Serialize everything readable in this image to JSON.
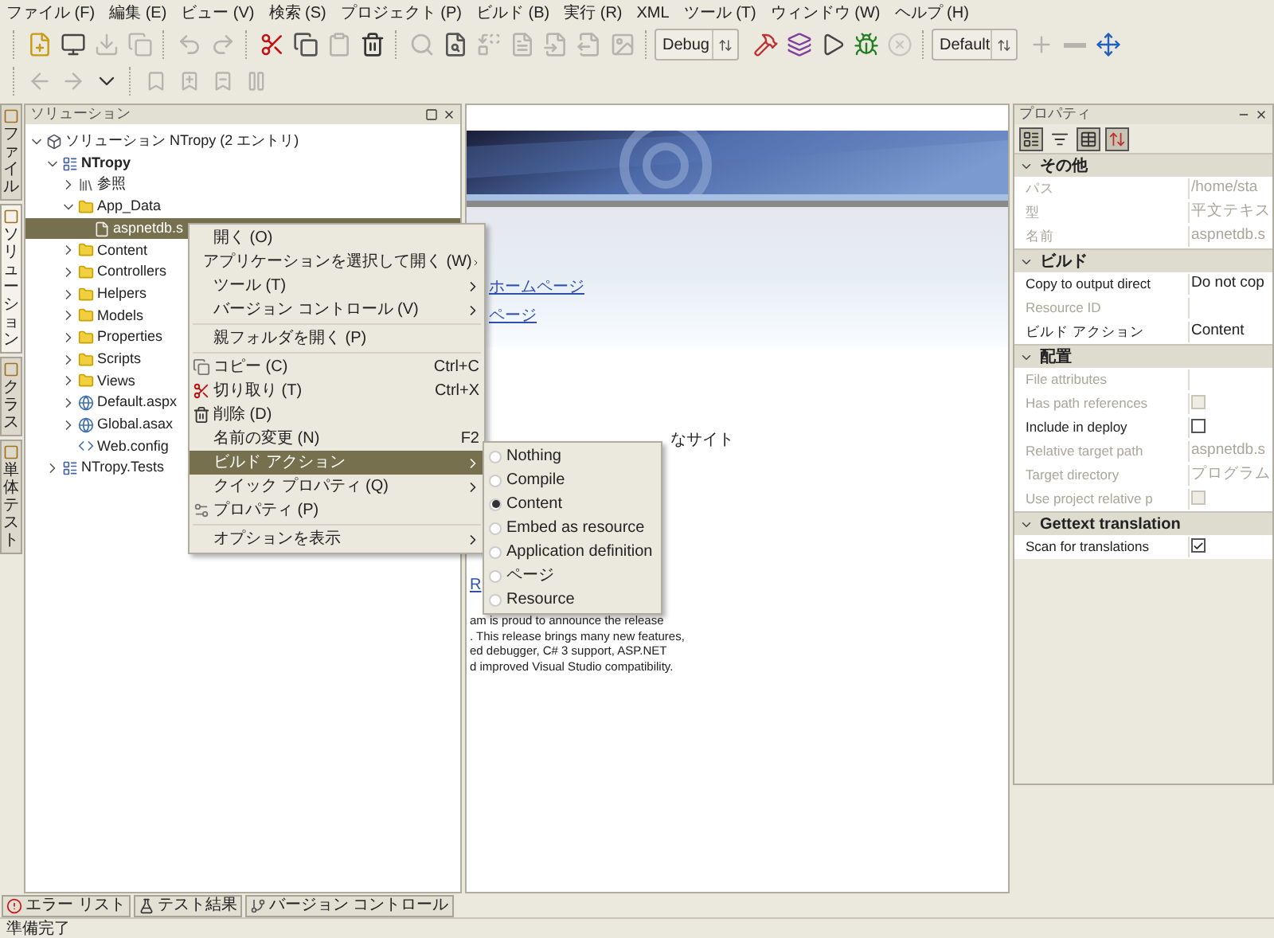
{
  "menubar": [
    "ファイル (F)",
    "編集 (E)",
    "ビュー (V)",
    "検索 (S)",
    "プロジェクト (P)",
    "ビルド (B)",
    "実行 (R)",
    "XML",
    "ツール (T)",
    "ウィンドウ (W)",
    "ヘルプ (H)"
  ],
  "toolbar": {
    "row1a": [
      {
        "disabled": false
      },
      {
        "disabled": false
      },
      {
        "disabled": true
      },
      {
        "disabled": true
      },
      {
        "disabled": true
      },
      {
        "disabled": true
      },
      {
        "disabled": false
      },
      {
        "disabled": false
      },
      {
        "disabled": true
      },
      {
        "disabled": false
      },
      {
        "disabled": true
      },
      {
        "disabled": false
      },
      {
        "disabled": true
      },
      {
        "disabled": true
      },
      {
        "disabled": true
      },
      {
        "disabled": true
      },
      {
        "disabled": true
      }
    ],
    "config_combo": "Debug",
    "row1b": [
      {
        "disabled": false
      },
      {
        "disabled": false
      },
      {
        "disabled": false
      },
      {
        "disabled": false
      },
      {
        "disabled": true
      }
    ],
    "layout_combo": "Default",
    "row1c": [
      {
        "disabled": true
      },
      {
        "disabled": true
      },
      {
        "disabled": false
      }
    ],
    "row2": [
      {
        "disabled": true
      },
      {
        "disabled": true
      },
      {
        "disabled": false
      },
      {
        "disabled": true
      },
      {
        "disabled": true
      },
      {
        "disabled": true
      },
      {
        "disabled": true
      }
    ]
  },
  "side_tabs": [
    {
      "label": "ファイル",
      "selected": false
    },
    {
      "label": "ソリューション",
      "selected": true
    },
    {
      "label": "クラス",
      "selected": false
    },
    {
      "label": "単体テスト",
      "selected": false
    }
  ],
  "solution_panel": {
    "title": "ソリューション",
    "tree": [
      {
        "label": "ソリューション NTropy (2 エントリ)",
        "kind": "solution",
        "expanded": true,
        "selected": false,
        "bold": false,
        "children": [
          {
            "label": "NTropy",
            "kind": "project",
            "expanded": true,
            "selected": false,
            "bold": true,
            "children": [
              {
                "label": "参照",
                "kind": "references",
                "expanded": false,
                "selected": false,
                "bold": false
              },
              {
                "label": "App_Data",
                "kind": "folder",
                "expanded": true,
                "selected": false,
                "bold": false,
                "children": [
                  {
                    "label": "aspnetdb.s",
                    "kind": "file",
                    "selected": true,
                    "bold": false
                  }
                ]
              },
              {
                "label": "Content",
                "kind": "folder",
                "expanded": false,
                "selected": false,
                "bold": false
              },
              {
                "label": "Controllers",
                "kind": "folder",
                "expanded": false,
                "selected": false,
                "bold": false
              },
              {
                "label": "Helpers",
                "kind": "folder",
                "expanded": false,
                "selected": false,
                "bold": false
              },
              {
                "label": "Models",
                "kind": "folder",
                "expanded": false,
                "selected": false,
                "bold": false
              },
              {
                "label": "Properties",
                "kind": "folder",
                "expanded": false,
                "selected": false,
                "bold": false
              },
              {
                "label": "Scripts",
                "kind": "folder",
                "expanded": false,
                "selected": false,
                "bold": false
              },
              {
                "label": "Views",
                "kind": "folder",
                "expanded": false,
                "selected": false,
                "bold": false
              },
              {
                "label": "Default.aspx",
                "kind": "web",
                "expanded": false,
                "selected": false,
                "bold": false
              },
              {
                "label": "Global.asax",
                "kind": "web",
                "expanded": false,
                "selected": false,
                "bold": false
              },
              {
                "label": "Web.config",
                "kind": "config",
                "selected": false,
                "bold": false
              }
            ]
          },
          {
            "label": "NTropy.Tests",
            "kind": "project",
            "expanded": false,
            "selected": false,
            "bold": false
          }
        ]
      }
    ]
  },
  "web_page": {
    "links": [
      "ホームページ",
      "ページ"
    ],
    "tagline": "なサイト",
    "link2": "R",
    "paragraph": [
      "am is proud to announce the release",
      ". This release brings many new features,",
      "ed debugger, C# 3 support,  ASP.NET",
      "d improved Visual Studio compatibility."
    ]
  },
  "context_menu": [
    {
      "kind": "item",
      "label": "開く (O)",
      "submenu": false,
      "selected": false
    },
    {
      "kind": "item",
      "label": "アプリケーションを選択して開く (W)",
      "submenu": true,
      "selected": false
    },
    {
      "kind": "item",
      "label": "ツール (T)",
      "submenu": true,
      "selected": false
    },
    {
      "kind": "item",
      "label": "バージョン コントロール (V)",
      "submenu": true,
      "selected": false
    },
    {
      "kind": "separator"
    },
    {
      "kind": "item",
      "label": "親フォルダを開く (P)",
      "submenu": false,
      "selected": false
    },
    {
      "kind": "separator"
    },
    {
      "kind": "item",
      "label": "コピー (C)",
      "shortcut": "Ctrl+C",
      "submenu": false,
      "selected": false
    },
    {
      "kind": "item",
      "label": "切り取り (T)",
      "shortcut": "Ctrl+X",
      "submenu": false,
      "selected": false
    },
    {
      "kind": "item",
      "label": "削除 (D)",
      "submenu": false,
      "selected": false
    },
    {
      "kind": "item",
      "label": "名前の変更 (N)",
      "shortcut": "F2",
      "submenu": false,
      "selected": false
    },
    {
      "kind": "item",
      "label": "ビルド アクション",
      "submenu": true,
      "selected": true
    },
    {
      "kind": "item",
      "label": "クイック プロパティ (Q)",
      "submenu": true,
      "selected": false
    },
    {
      "kind": "item",
      "label": "プロパティ (P)",
      "submenu": false,
      "selected": false
    },
    {
      "kind": "separator"
    },
    {
      "kind": "item",
      "label": "オプションを表示",
      "submenu": true,
      "selected": false
    }
  ],
  "build_action_menu": [
    {
      "label": "Nothing",
      "selected": false
    },
    {
      "label": "Compile",
      "selected": false
    },
    {
      "label": "Content",
      "selected": true
    },
    {
      "label": "Embed as resource",
      "selected": false
    },
    {
      "label": "Application definition",
      "selected": false
    },
    {
      "label": "ページ",
      "selected": false
    },
    {
      "label": "Resource",
      "selected": false
    }
  ],
  "properties_panel": {
    "title": "プロパティ",
    "toolbar": [
      {
        "selected": true
      },
      {
        "selected": false
      },
      {
        "selected": true
      },
      {
        "selected": true
      }
    ],
    "categories": [
      {
        "name": "その他",
        "rows": [
          {
            "name": "パス",
            "kind": "text",
            "value": "/home/sta",
            "disabled": true
          },
          {
            "name": "型",
            "kind": "text",
            "value": "平文テキス",
            "disabled": true
          },
          {
            "name": "名前",
            "kind": "text",
            "value": "aspnetdb.s",
            "disabled": true
          }
        ]
      },
      {
        "name": "ビルド",
        "rows": [
          {
            "name": "Copy to output direct",
            "kind": "text",
            "value": "Do not cop",
            "disabled": false
          },
          {
            "name": "Resource ID",
            "kind": "text",
            "disabled": true
          },
          {
            "name": "ビルド アクション",
            "kind": "text",
            "value": "Content",
            "disabled": false
          }
        ]
      },
      {
        "name": "配置",
        "rows": [
          {
            "name": "File attributes",
            "kind": "text",
            "disabled": true
          },
          {
            "name": "Has path references",
            "kind": "checkbox",
            "checked": false,
            "disabled": true
          },
          {
            "name": "Include in deploy",
            "kind": "checkbox",
            "checked": false,
            "disabled": false
          },
          {
            "name": "Relative target path",
            "kind": "text",
            "value": "aspnetdb.s",
            "disabled": true
          },
          {
            "name": "Target directory",
            "kind": "text",
            "value": "プログラム",
            "disabled": true
          },
          {
            "name": "Use project relative p",
            "kind": "checkbox",
            "checked": false,
            "disabled": true
          }
        ]
      },
      {
        "name": "Gettext translation",
        "rows": [
          {
            "name": "Scan for translations",
            "kind": "checkbox",
            "checked": true,
            "disabled": false
          }
        ]
      }
    ]
  },
  "bottom_tabs": [
    {
      "label": "エラー リスト"
    },
    {
      "label": "テスト結果"
    },
    {
      "label": "バージョン コントロール"
    }
  ],
  "status_bar": "準備完了"
}
